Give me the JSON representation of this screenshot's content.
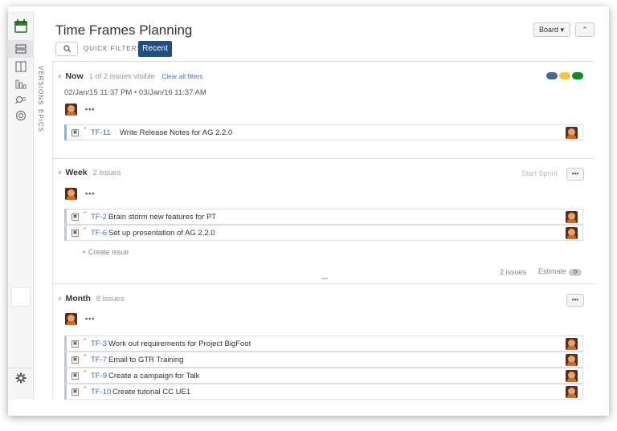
{
  "header": {
    "title": "Time Frames Planning",
    "quick_filters_label": "QUICK FILTERS:",
    "quick_filter_recent": "Recent",
    "board_button": "Board ▾",
    "collapse_button": "⌃"
  },
  "vertical_tabs": {
    "versions": "VERSIONS",
    "epics": "EPICS"
  },
  "icons": {
    "logo": "calendar-icon",
    "backlog": "backlog-icon",
    "board": "board-icon",
    "reports": "reports-icon",
    "search": "search-icon",
    "components": "components-icon",
    "settings": "gear-icon"
  },
  "colors": {
    "accent": "#205081",
    "link": "#3b73af",
    "pill_blue": "#4a6785",
    "pill_yellow": "#f6c342",
    "pill_green": "#14892c"
  },
  "sections": {
    "now": {
      "name": "Now",
      "count": "1 of 2 issues visible",
      "clear": "Clear all filters",
      "dates": "02/Jan/15 11:37 PM • 03/Jan/16 11:37 AM",
      "issues": [
        {
          "key": "TF-11",
          "summary": "Write Release Notes for AG 2.2.0"
        }
      ]
    },
    "week": {
      "name": "Week",
      "count": "2 issues",
      "start_sprint": "Start Sprint",
      "create_issue": "+ Create issue",
      "footer_count": "2 issues",
      "estimate_label": "Estimate",
      "estimate_value": "0",
      "issues": [
        {
          "key": "TF-2",
          "summary": "Brain storm new features for PT"
        },
        {
          "key": "TF-6",
          "summary": "Set up presentation of AG 2.2.0"
        }
      ]
    },
    "month": {
      "name": "Month",
      "count": "8 issues",
      "issues": [
        {
          "key": "TF-3",
          "summary": "Work out requirements for Project BigFoot"
        },
        {
          "key": "TF-7",
          "summary": "Email to GTR Training"
        },
        {
          "key": "TF-9",
          "summary": "Create a campaign for Talk"
        },
        {
          "key": "TF-10",
          "summary": "Create tutorial CC UE1"
        }
      ]
    }
  },
  "dots_label": "•••"
}
